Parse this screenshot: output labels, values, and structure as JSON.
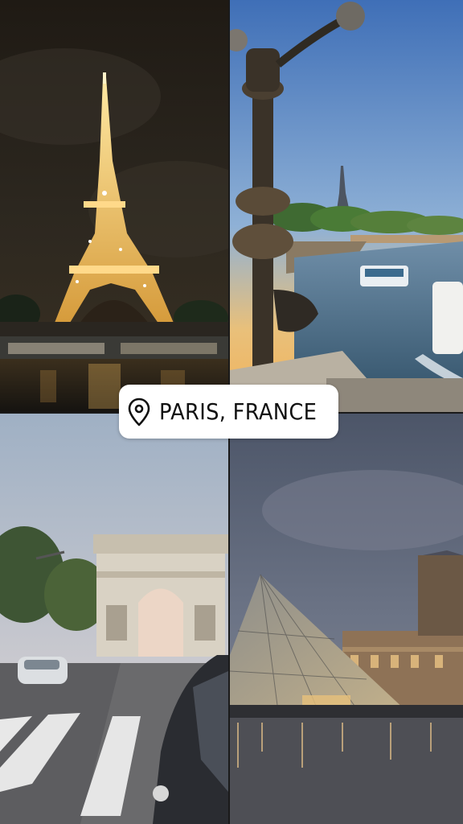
{
  "story": {
    "location_sticker": {
      "icon": "map-pin-icon",
      "label": "PARIS, FRANCE"
    },
    "photos": [
      {
        "name": "eiffel-tower-night"
      },
      {
        "name": "seine-river-lamp-post"
      },
      {
        "name": "arc-de-triomphe"
      },
      {
        "name": "louvre-pyramid"
      }
    ]
  }
}
